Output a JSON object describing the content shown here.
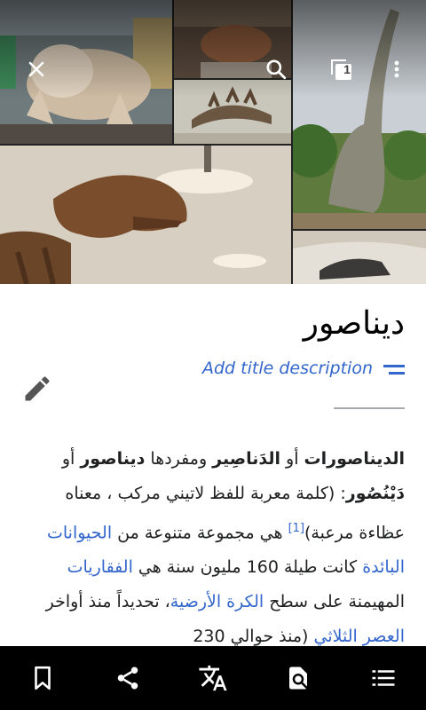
{
  "article": {
    "title": "ديناصور",
    "add_description": "Add title description",
    "paragraph": {
      "b1": "الديناصورات",
      "t1": " أو ",
      "b2": "الدَناصِير",
      "t2": " ومفردها ",
      "b3": "ديناصور",
      "t3": " أو ",
      "b4": "دَيْنُصُور",
      "t4": ": (كلمة معربة للفظ لاتيني مركب ، معناه عظاءة مرعبة)",
      "ref": "[1]",
      "t5": " هي مجموعة متنوعة من ",
      "link1": "الحيوانات البائدة",
      "t6": " كانت طيلة 160 مليون سنة هي ",
      "link2": "الفقاريات",
      "t7": " المهيمنة على سطح ",
      "link3": "الكرة الأرضية",
      "t8": "، تحديداً منذ أواخر ",
      "link4": "العصر الثلاثي",
      "t9": " (منذ حوالي 230"
    }
  },
  "toolbar": {
    "close_icon": "close-icon",
    "search_icon": "search-icon",
    "tabs_count": "1",
    "overflow_icon": "more-vertical-icon"
  },
  "bottom_bar": {
    "items": [
      "bookmark-icon",
      "share-icon",
      "translate-icon",
      "find-in-page-icon",
      "contents-icon"
    ]
  },
  "colors": {
    "link": "#3366cc",
    "text": "#202122",
    "bar": "#000000"
  }
}
